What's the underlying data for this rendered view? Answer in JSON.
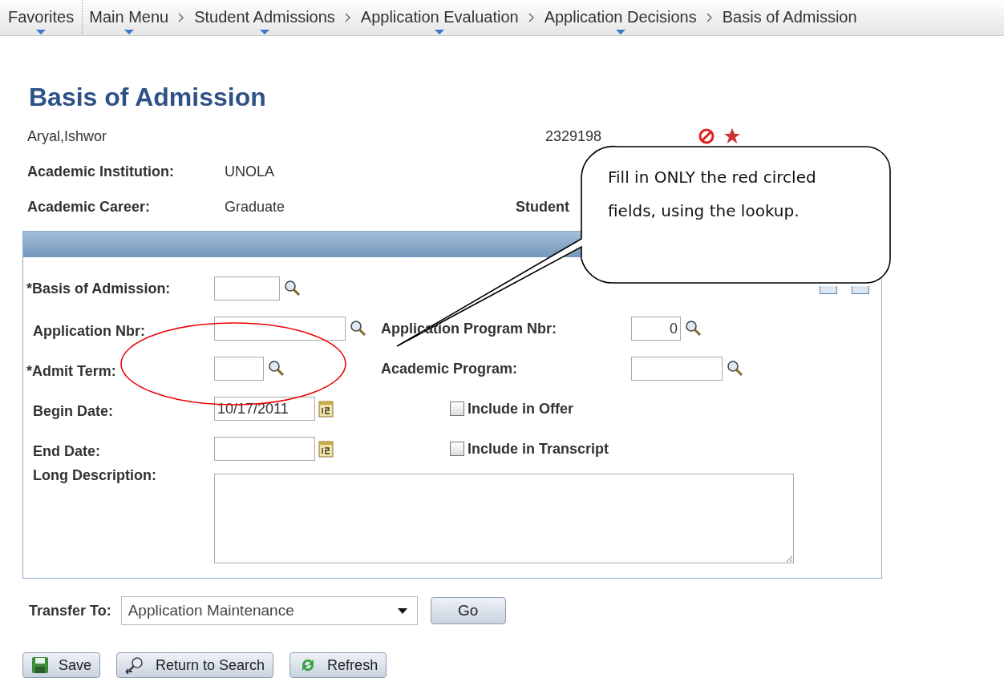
{
  "breadcrumbs": [
    {
      "label": "Favorites",
      "has_menu": true
    },
    {
      "label": "Main Menu",
      "has_menu": true
    },
    {
      "label": "Student Admissions",
      "has_menu": true
    },
    {
      "label": "Application Evaluation",
      "has_menu": true
    },
    {
      "label": "Application Decisions",
      "has_menu": true
    },
    {
      "label": "Basis of Admission",
      "has_menu": false
    }
  ],
  "page_title": "Basis of Admission",
  "student": {
    "name": "Aryal,Ishwor",
    "id": "2329198"
  },
  "header_fields": [
    {
      "label": "Academic Institution:",
      "value": "UNOLA"
    },
    {
      "label": "Academic Career:",
      "value": "Graduate",
      "extra_label": "Student"
    }
  ],
  "form_rows": [
    {
      "label": "*Basis of Admission:",
      "kind": "lookup"
    },
    {
      "label": "Application Nbr:",
      "kind": "lookup",
      "right": {
        "label": "Application Program Nbr:",
        "kind": "lookup",
        "value": "0"
      }
    },
    {
      "label": "*Admit Term:",
      "kind": "lookup",
      "right": {
        "label": "Academic Program:",
        "kind": "lookup"
      }
    },
    {
      "label": "Begin Date:",
      "kind": "date",
      "value": "10/17/2011",
      "right": {
        "label": "Include in Offer",
        "kind": "checkbox",
        "checked": false
      }
    },
    {
      "label": "End Date:",
      "kind": "date",
      "right": {
        "label": "Include in Transcript",
        "kind": "checkbox",
        "checked": false
      }
    },
    {
      "label": "Long Description:",
      "kind": "textarea"
    }
  ],
  "transfer": {
    "label": "Transfer To:",
    "value": "Application Maintenance",
    "go": "Go"
  },
  "actions": [
    {
      "kind": "save",
      "label": "Save"
    },
    {
      "kind": "search",
      "label": "Return to Search"
    },
    {
      "kind": "refresh",
      "label": "Refresh"
    }
  ],
  "callout": {
    "text": "Fill in ONLY the red circled fields, using the lookup."
  }
}
